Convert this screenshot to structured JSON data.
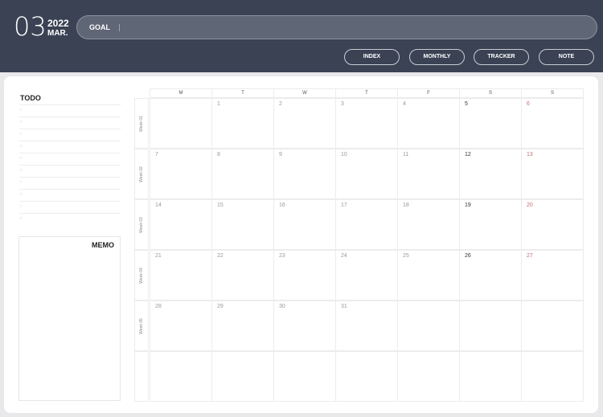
{
  "header": {
    "month_num": "03",
    "year": "2022",
    "month_abbr": "MAR.",
    "goal_label": "GOAL",
    "goal_value": "",
    "nav": [
      "INDEX",
      "MONTHLY",
      "TRACKER",
      "NOTE"
    ]
  },
  "todo": {
    "title": "TODO",
    "items": 10,
    "check_glyph": "○"
  },
  "memo": {
    "title": "MEMO"
  },
  "calendar": {
    "weekdays": [
      "M",
      "T",
      "W",
      "T",
      "F",
      "S",
      "S"
    ],
    "week_labels": [
      "Week 01",
      "Week 02",
      "Week 03",
      "Week 04",
      "Week 05",
      ""
    ],
    "weeks": [
      [
        "",
        "1",
        "2",
        "3",
        "4",
        "5",
        "6"
      ],
      [
        "7",
        "8",
        "9",
        "10",
        "11",
        "12",
        "13"
      ],
      [
        "14",
        "15",
        "16",
        "17",
        "18",
        "19",
        "20"
      ],
      [
        "21",
        "22",
        "23",
        "24",
        "25",
        "26",
        "27"
      ],
      [
        "28",
        "29",
        "30",
        "31",
        "",
        "",
        ""
      ],
      [
        "",
        "",
        "",
        "",
        "",
        "",
        ""
      ]
    ]
  },
  "colors": {
    "header_bg": "#3a4254",
    "sunday": "#c46d78",
    "saturday": "#333333"
  }
}
